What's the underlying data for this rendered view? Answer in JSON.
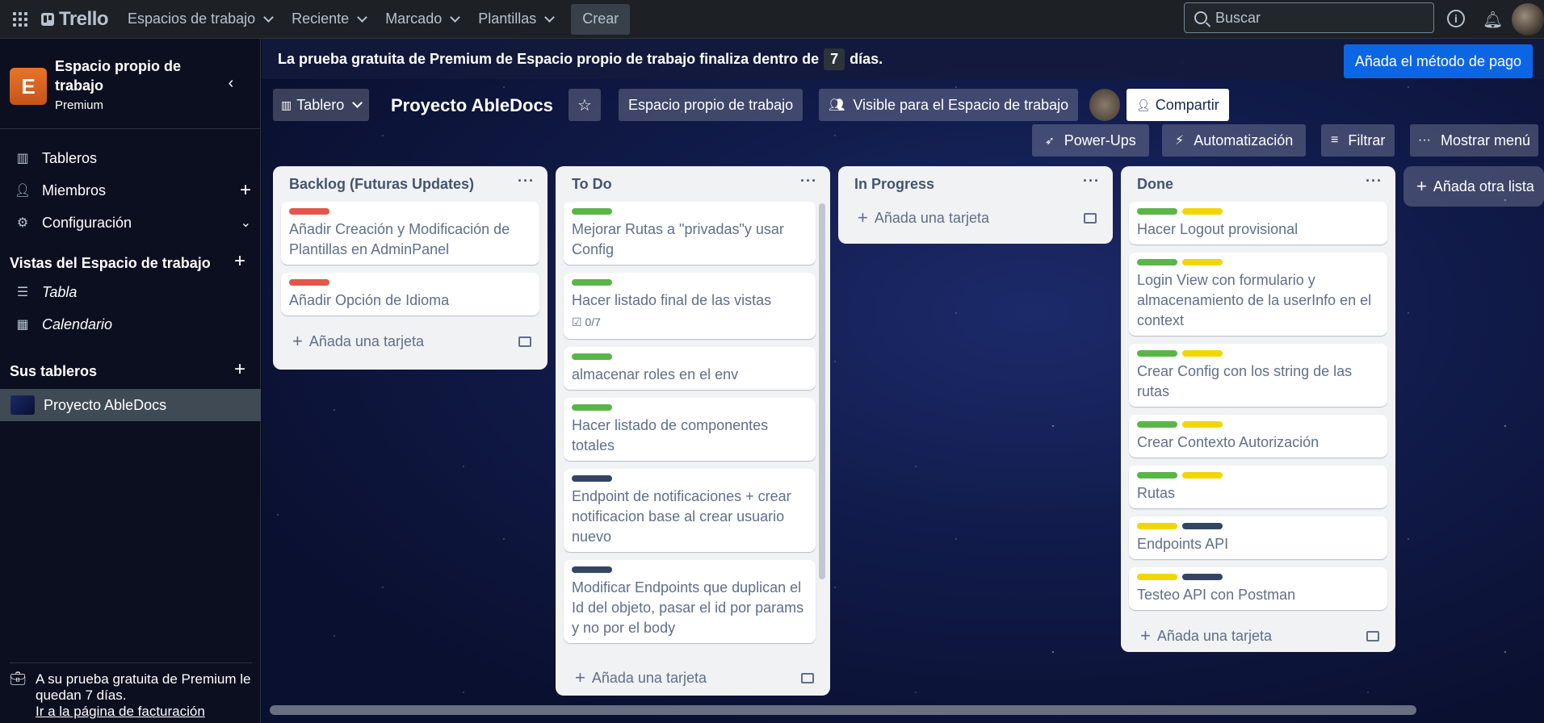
{
  "topbar": {
    "brand": "Trello",
    "nav": [
      "Espacios de trabajo",
      "Reciente",
      "Marcado",
      "Plantillas"
    ],
    "create_label": "Crear",
    "search_placeholder": "Buscar"
  },
  "sidebar": {
    "workspace_initial": "E",
    "workspace_name": "Espacio propio de trabajo",
    "workspace_plan": "Premium",
    "items": [
      {
        "label": "Tableros",
        "icon": "board-icon"
      },
      {
        "label": "Miembros",
        "icon": "person-icon"
      },
      {
        "label": "Configuración",
        "icon": "gear-icon"
      }
    ],
    "views_heading": "Vistas del Espacio de trabajo",
    "views": [
      {
        "label": "Tabla",
        "icon": "table-icon"
      },
      {
        "label": "Calendario",
        "icon": "calendar-icon"
      }
    ],
    "boards_heading": "Sus tableros",
    "boards": [
      "Proyecto AbleDocs"
    ],
    "trial_text": "A su prueba gratuita de Premium le quedan 7 días.",
    "trial_link": "Ir a la página de facturación"
  },
  "banner": {
    "text_before": "La prueba gratuita de Premium de Espacio propio de trabajo finaliza dentro de",
    "days": "7",
    "text_after": "días.",
    "button": "Añada el método de pago"
  },
  "board": {
    "view_label": "Tablero",
    "title": "Proyecto AbleDocs",
    "workspace_button": "Espacio propio de trabajo",
    "visibility": "Visible para el Espacio de trabajo",
    "share": "Compartir",
    "powerups": "Power-Ups",
    "automation": "Automatización",
    "filter": "Filtrar",
    "menu": "Mostrar menú",
    "add_list": "Añada otra lista",
    "add_card": "Añada una tarjeta"
  },
  "colors": {
    "red": "#e2564b",
    "green": "#5ab549",
    "yellow": "#f2d600",
    "navy": "#344563",
    "accent": "#0c66e4"
  },
  "lists": [
    {
      "title": "Backlog (Futuras Updates)",
      "cards": [
        {
          "labels": [
            "red"
          ],
          "text": "Añadir Creación y Modificación de Plantillas en AdminPanel"
        },
        {
          "labels": [
            "red"
          ],
          "text": "Añadir Opción de Idioma"
        }
      ]
    },
    {
      "title": "To Do",
      "cards": [
        {
          "labels": [
            "green"
          ],
          "text": "Mejorar Rutas a \"privadas\"y usar Config"
        },
        {
          "labels": [
            "green"
          ],
          "text": "Hacer listado final de las vistas",
          "badge": "0/7"
        },
        {
          "labels": [
            "green"
          ],
          "text": "almacenar roles en el env"
        },
        {
          "labels": [
            "green"
          ],
          "text": "Hacer listado de componentes totales"
        },
        {
          "labels": [
            "navy"
          ],
          "text": "Endpoint de notificaciones + crear notificacion base al crear usuario nuevo"
        },
        {
          "labels": [
            "navy"
          ],
          "text": "Modificar Endpoints que duplican el Id del objeto, pasar el id por params y no por el body"
        }
      ]
    },
    {
      "title": "In Progress",
      "cards": []
    },
    {
      "title": "Done",
      "cards": [
        {
          "labels": [
            "green",
            "yellow"
          ],
          "text": "Hacer Logout provisional"
        },
        {
          "labels": [
            "green",
            "yellow"
          ],
          "text": "Login View con formulario y almacenamiento de la userInfo en el context"
        },
        {
          "labels": [
            "green",
            "yellow"
          ],
          "text": "Crear Config con los string de las rutas"
        },
        {
          "labels": [
            "green",
            "yellow"
          ],
          "text": "Crear Contexto Autorización"
        },
        {
          "labels": [
            "green",
            "yellow"
          ],
          "text": "Rutas"
        },
        {
          "labels": [
            "yellow",
            "navy"
          ],
          "text": "Endpoints API"
        },
        {
          "labels": [
            "yellow",
            "navy"
          ],
          "text": "Testeo API con Postman"
        }
      ]
    }
  ]
}
